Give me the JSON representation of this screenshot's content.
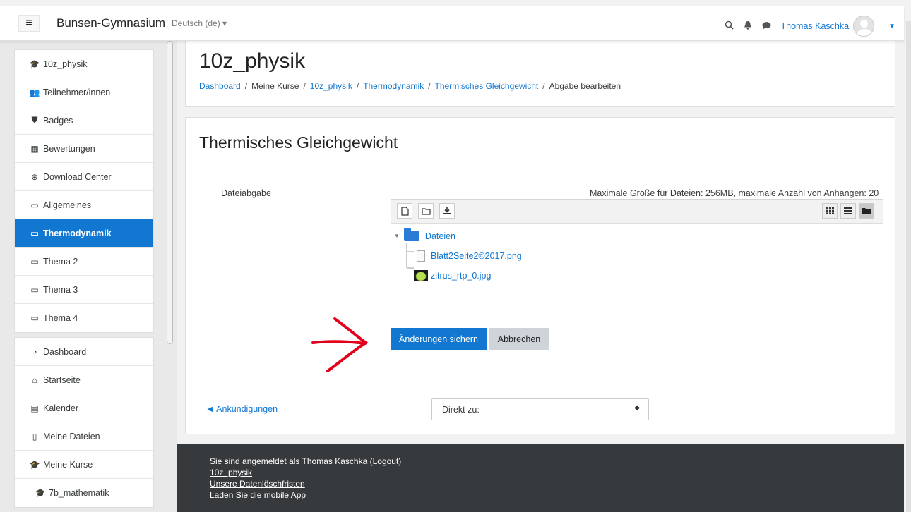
{
  "navbar": {
    "menu_icon": "hamburger-icon",
    "site_name": "Bunsen-Gymnasium",
    "language": "Deutsch (de) ▾",
    "user_name": "Thomas Kaschka",
    "icons": [
      "search-icon",
      "bell-icon",
      "chat-icon",
      "chevron-down-icon"
    ]
  },
  "sidebar": {
    "course_items": [
      {
        "icon": "graduation-cap-icon",
        "label": "10z_physik"
      },
      {
        "icon": "users-icon",
        "label": "Teilnehmer/innen"
      },
      {
        "icon": "shield-icon",
        "label": "Badges"
      },
      {
        "icon": "table-icon",
        "label": "Bewertungen"
      },
      {
        "icon": "download-icon",
        "label": "Download Center"
      },
      {
        "icon": "folder-icon",
        "label": "Allgemeines"
      },
      {
        "icon": "folder-icon",
        "label": "Thermodynamik",
        "active": true
      },
      {
        "icon": "folder-icon",
        "label": "Thema 2"
      },
      {
        "icon": "folder-icon",
        "label": "Thema 3"
      },
      {
        "icon": "folder-icon",
        "label": "Thema 4"
      }
    ],
    "site_items": [
      {
        "icon": "dashboard-icon",
        "label": "Dashboard"
      },
      {
        "icon": "home-icon",
        "label": "Startseite"
      },
      {
        "icon": "calendar-icon",
        "label": "Kalender"
      },
      {
        "icon": "file-icon",
        "label": "Meine Dateien"
      },
      {
        "icon": "graduation-cap-icon",
        "label": "Meine Kurse"
      },
      {
        "icon": "graduation-cap-icon",
        "label": "7b_mathematik"
      }
    ]
  },
  "header": {
    "title": "10z_physik",
    "breadcrumb": {
      "dashboard": "Dashboard",
      "my_courses": "Meine Kurse",
      "course": "10z_physik",
      "section": "Thermodynamik",
      "activity": "Thermisches Gleichgewicht",
      "current": "Abgabe bearbeiten",
      "separator": "/"
    }
  },
  "main": {
    "title": "Thermisches Gleichgewicht",
    "field_label": "Dateiabgabe",
    "max_info": "Maximale Größe für Dateien: 256MB, maximale Anzahl von Anhängen: 20",
    "toolbar_left": [
      "add-file-icon",
      "create-folder-icon",
      "download-all-icon"
    ],
    "toolbar_right": [
      "grid-view-icon",
      "list-view-icon",
      "tree-view-icon"
    ],
    "tree": {
      "root": "Dateien",
      "files": [
        "Blatt2Seite2©2017.png",
        "zitrus_rtp_0.jpg"
      ]
    },
    "save_button": "Änderungen sichern",
    "cancel_button": "Abbrechen",
    "prev_link": "◄ Ankündigungen",
    "jump_select": "Direkt zu:"
  },
  "footer": {
    "logged_in_prefix": "Sie sind angemeldet als ",
    "user": "Thomas Kaschka",
    "logout": "(Logout)",
    "course_link": "10z_physik",
    "retention": "Unsere Datenlöschfristen",
    "mobile_app": "Laden Sie die mobile App"
  },
  "colors": {
    "brand": "#1177d1",
    "footer_bg": "#373a3c",
    "annotation_arrow": "#e3001b"
  }
}
